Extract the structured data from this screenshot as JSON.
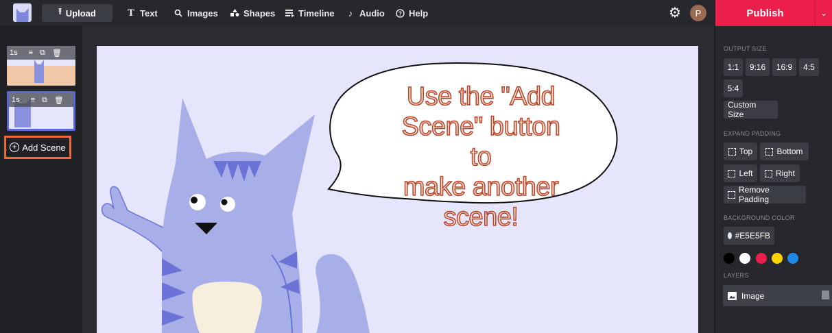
{
  "topbar": {
    "upload_label": "Upload",
    "nav": [
      {
        "label": "Text",
        "icon": "text-icon"
      },
      {
        "label": "Images",
        "icon": "search-icon"
      },
      {
        "label": "Shapes",
        "icon": "shapes-icon"
      },
      {
        "label": "Timeline",
        "icon": "timeline-icon"
      },
      {
        "label": "Audio",
        "icon": "music-icon"
      },
      {
        "label": "Help",
        "icon": "help-icon"
      }
    ],
    "avatar_initial": "P",
    "publish_label": "Publish"
  },
  "scenes": [
    {
      "duration": "1s"
    },
    {
      "duration": "1s"
    }
  ],
  "add_scene_label": "Add Scene",
  "canvas": {
    "background_color": "#E5E5FB",
    "speech_lines": [
      "Use the \"Add",
      "Scene\" button to",
      "make another",
      "scene!"
    ]
  },
  "right_panel": {
    "output_size_label": "OUTPUT SIZE",
    "sizes": [
      "1:1",
      "9:16",
      "16:9",
      "4:5",
      "5:4"
    ],
    "custom_size_label": "Custom Size",
    "expand_padding_label": "EXPAND PADDING",
    "padding": {
      "top": "Top",
      "bottom": "Bottom",
      "left": "Left",
      "right": "Right",
      "remove": "Remove Padding"
    },
    "background_color_label": "BACKGROUND COLOR",
    "background_color_value": "#E5E5FB",
    "swatches": [
      "#000000",
      "#ffffff",
      "#ec1f4b",
      "#ffd400",
      "#1e88e5"
    ],
    "layers_label": "LAYERS",
    "layer_name": "Image"
  },
  "colors": {
    "accent": "#ec1f4b",
    "scene_highlight": "#ef6a3a",
    "selected_scene": "#5b67d6"
  }
}
